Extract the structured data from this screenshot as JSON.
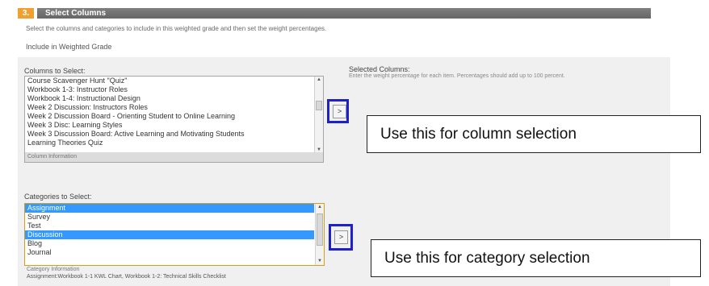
{
  "section": {
    "number": "3.",
    "title": "Select Columns",
    "instructions": "Select the columns and categories to include in this weighted grade and then set the weight percentages.",
    "include_label": "Include in Weighted Grade"
  },
  "columns": {
    "label": "Columns to Select:",
    "items": [
      "Course Scavenger Hunt \"Quiz\"",
      "Workbook 1-3: Instructor Roles",
      "Workbook 1-4: Instructional Design",
      "Week 2 Discussion: Instructors Roles",
      "Week 2 Discussion Board - Orienting Student to Online Learning",
      "Week 3 Disc: Learning Styles",
      "Week 3 Discussion Board: Active Learning and Motivating Students",
      "Learning Theories Quiz"
    ],
    "info_label": "Column Information",
    "move_button": ">"
  },
  "categories": {
    "label": "Categories to Select:",
    "items": [
      {
        "label": "Assignment",
        "selected": true
      },
      {
        "label": "Survey",
        "selected": false
      },
      {
        "label": "Test",
        "selected": false
      },
      {
        "label": "Discussion",
        "selected": true
      },
      {
        "label": "Blog",
        "selected": false
      },
      {
        "label": "Journal",
        "selected": false
      }
    ],
    "info_label": "Category Information",
    "info_text": "Assignment:Workbook 1-1 KWL Chart, Workbook 1-2: Technical Skills Checklist",
    "move_button": ">"
  },
  "selected": {
    "title": "Selected Columns:",
    "description": "Enter the weight percentage for each item. Percentages should add up to 100 percent."
  },
  "callouts": {
    "column": "Use this for column selection",
    "category": "Use this for category selection"
  },
  "colors": {
    "step_badge": "#f0a030",
    "header_bar": "#707070",
    "selection": "#3399ff",
    "highlight_border": "#2020c8",
    "list_focus_border": "#d4a017"
  }
}
